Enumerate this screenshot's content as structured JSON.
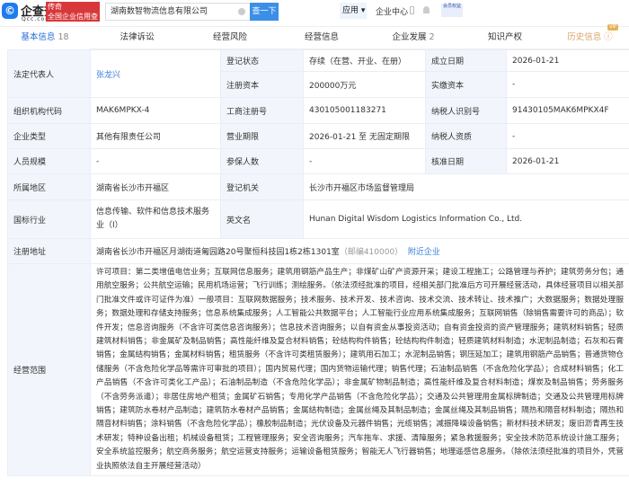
{
  "header": {
    "logo_glyph": "©",
    "brand": "企查查",
    "brand_sub": "Qcc.com",
    "slogan1": "传奇",
    "slogan2": "全国企业信用查询",
    "search_value": "湖南数智物流信息有限公司",
    "search_button": "查一下",
    "apps": "应用",
    "enterprise_center": "企业中心",
    "vip": "会员权益"
  },
  "tabs": [
    {
      "label": "基本信息",
      "count": "18"
    },
    {
      "label": "法律诉讼"
    },
    {
      "label": "经营风险"
    },
    {
      "label": "经营信息"
    },
    {
      "label": "企业发展",
      "count": "2"
    },
    {
      "label": "知识产权"
    },
    {
      "label": "历史信息",
      "badge": "VIP"
    }
  ],
  "info": {
    "legal_rep_label": "法定代表人",
    "legal_rep": "张龙兴",
    "status_label": "登记状态",
    "status": "存续（在营、开业、在册）",
    "founded_label": "成立日期",
    "founded": "2026-01-21",
    "capital_label": "注册资本",
    "capital": "200000万元",
    "paid_label": "实缴资本",
    "paid": "-",
    "org_code_label": "组织机构代码",
    "org_code": "MAK6MPKX-4",
    "reg_no_label": "工商注册号",
    "reg_no": "430105001183271",
    "tax_id_label": "纳税人识别号",
    "tax_id": "91430105MAK6MPKX4F",
    "type_label": "企业类型",
    "type": "其他有限责任公司",
    "term_label": "营业期限",
    "term": "2026-01-21 至 无固定期限",
    "tax_q_label": "纳税人资质",
    "tax_q": "-",
    "staff_label": "人员规模",
    "staff": "-",
    "insured_label": "参保人数",
    "insured": "-",
    "approved_label": "核准日期",
    "approved": "2026-01-21",
    "region_label": "所属地区",
    "region": "湖南省长沙市开福区",
    "authority_label": "登记机关",
    "authority": "长沙市开福区市场监督管理局",
    "industry_label": "国标行业",
    "industry": "信息传输、软件和信息技术服务业（I）",
    "en_name_label": "英文名",
    "en_name": "Hunan Digital Wisdom Logistics Information Co., Ltd.",
    "address_label": "注册地址",
    "address": "湖南省长沙市开福区月湖街道匍园路20号聚恒科技园1栋2栋1301室",
    "postcode": "（邮编410000）",
    "nearby": "附近企业",
    "scope_label": "经营范围",
    "scope": "许可项目：第二类增值电信业务；互联网信息服务；建筑用钢筋产品生产；非煤矿山矿产资源开采；建设工程施工；公路管理与养护；建筑劳务分包；通用航空服务；公共航空运输；民用机场运营；飞行训练；测绘服务。（依法须经批准的项目，经相关部门批准后方可开展经营活动，具体经营项目以相关部门批准文件或许可证件为准）一般项目：互联网数据服务；技术服务、技术开发、技术咨询、技术交流、技术转让、技术推广；大数据服务；数据处理服务；数据处理和存储支持服务；信息系统集成服务；人工智能公共数据平台；人工智能行业应用系统集成服务；互联网销售（除销售需要许可的商品）；软件开发；信息咨询服务（不含许可类信息咨询服务）；信息技术咨询服务；以自有资金从事投资活动；自有资金投资的资产管理服务；建筑材料销售；轻质建筑材料销售；非金属矿及制品销售；高性能纤维及复合材料销售；砼结构构件销售；砼结构构件制造；轻质建筑材料制造；水泥制品制造；石灰和石膏销售；金属结构销售；金属材料销售；租赁服务（不含许可类租赁服务）；建筑用石加工；水泥制品销售；钢压延加工；建筑用钢筋产品销售；普通货物仓储服务（不含危险化学品等需许可审批的项目）；国内贸易代理；国内货物运输代理；销售代理；石油制品销售（不含危险化学品）；合成材料销售；化工产品销售（不含许可类化工产品）；石油制品制造（不含危险化学品）；非金属矿物制品制造；高性能纤维及复合材料制造；煤炭及制品销售；劳务服务（不含劳务派遣）；非居住房地产租赁；金属矿石销售；专用化学产品销售（不含危险化学品）；交通及公共管理用金属标牌制造；交通及公共管理用标牌销售；建筑防水卷材产品制造；建筑防水卷材产品销售；金属结构制造；金属丝绳及其制品制造；金属丝绳及其制品销售；隔热和隔音材料制造；隔热和隔音材料销售；涂料销售（不含危险化学品）；橡胶制品制造；光伏设备及元器件销售；光缆销售；减振降噪设备销售；新材料技术研发；废旧沥青再生技术研发；特种设备出租；机械设备租赁；工程管理服务；安全咨询服务；汽车拖车、求援、清障服务；紧急救援服务；安全技术防范系统设计施工服务；安全系统监控服务；航空商务服务；航空运营支持服务；运输设备租赁服务；智能无人飞行器销售；地理遥感信息服务。（除依法须经批准的项目外，凭营业执照依法自主开展经营活动）"
  }
}
